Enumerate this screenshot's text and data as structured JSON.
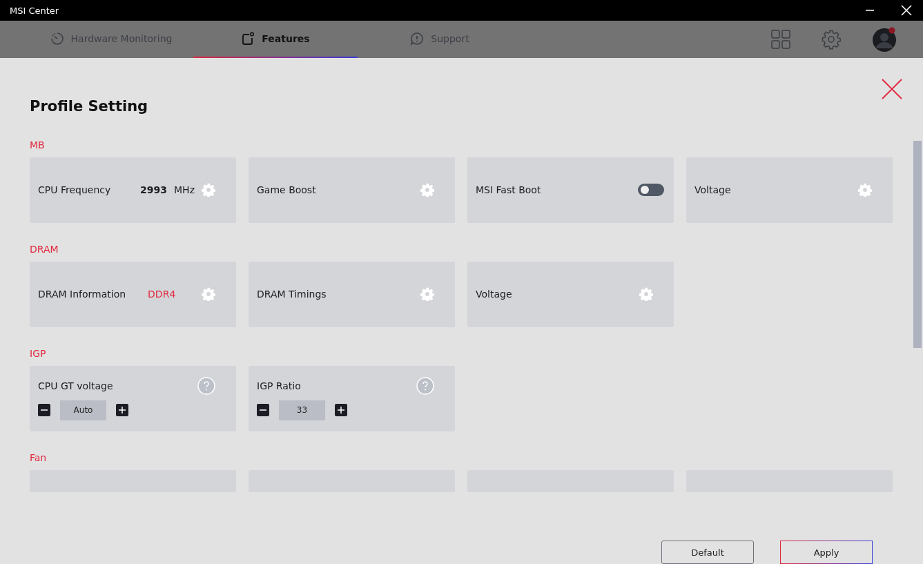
{
  "window": {
    "title": "MSI Center"
  },
  "tabs": [
    {
      "label": "Hardware Monitoring",
      "kind": "monitor",
      "selected": false
    },
    {
      "label": "Features",
      "kind": "features",
      "selected": true
    },
    {
      "label": "Support",
      "kind": "support",
      "selected": false
    }
  ],
  "dialog": {
    "title": "Profile Setting",
    "sections": [
      {
        "title": "MB",
        "cards": [
          {
            "kind": "gear",
            "label": "CPU Frequency",
            "value": "2993",
            "unit": "MHz"
          },
          {
            "kind": "gear",
            "label": "Game Boost"
          },
          {
            "kind": "toggle",
            "label": "MSI Fast Boot",
            "on": false
          },
          {
            "kind": "gear",
            "label": "Voltage"
          }
        ]
      },
      {
        "title": "DRAM",
        "cards": [
          {
            "kind": "gear",
            "label": "DRAM Information",
            "tag": "DDR4"
          },
          {
            "kind": "gear",
            "label": "DRAM Timings"
          },
          {
            "kind": "gear",
            "label": "Voltage"
          }
        ]
      },
      {
        "title": "IGP",
        "cards": [
          {
            "kind": "stepper",
            "label": "CPU GT voltage",
            "value": "Auto"
          },
          {
            "kind": "stepper",
            "label": "IGP Ratio",
            "value": "33"
          }
        ]
      },
      {
        "title": "Fan",
        "cards": [
          {
            "kind": "empty"
          },
          {
            "kind": "empty"
          },
          {
            "kind": "empty"
          },
          {
            "kind": "empty"
          }
        ]
      }
    ],
    "buttons": [
      {
        "label": "Default",
        "kind": "default"
      },
      {
        "label": "Apply",
        "kind": "apply"
      }
    ]
  }
}
